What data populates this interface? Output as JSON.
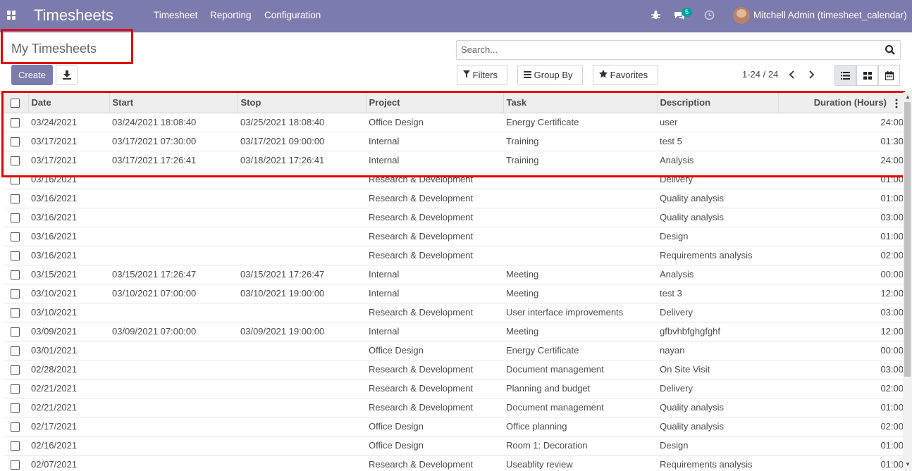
{
  "navbar": {
    "brand": "Timesheets",
    "menus": [
      "Timesheet",
      "Reporting",
      "Configuration"
    ],
    "chat_badge": "5",
    "user": "Mitchell Admin (timesheet_calendar)",
    "color": "#7c7bad"
  },
  "control": {
    "title": "My Timesheets",
    "create_label": "Create",
    "search_placeholder": "Search...",
    "filters_label": "Filters",
    "group_by_label": "Group By",
    "favorites_label": "Favorites",
    "pager": "1-24 / 24"
  },
  "table": {
    "columns": [
      "Date",
      "Start",
      "Stop",
      "Project",
      "Task",
      "Description",
      "Duration (Hours)"
    ],
    "rows": [
      [
        "03/24/2021",
        "03/24/2021 18:08:40",
        "03/25/2021 18:08:40",
        "Office Design",
        "Energy Certificate",
        "user",
        "24:00"
      ],
      [
        "03/17/2021",
        "03/17/2021 07:30:00",
        "03/17/2021 09:00:00",
        "Internal",
        "Training",
        "test 5",
        "01:30"
      ],
      [
        "03/17/2021",
        "03/17/2021 17:26:41",
        "03/18/2021 17:26:41",
        "Internal",
        "Training",
        "Analysis",
        "24:00"
      ],
      [
        "03/16/2021",
        "",
        "",
        "Research & Development",
        "",
        "Delivery",
        "01:00"
      ],
      [
        "03/16/2021",
        "",
        "",
        "Research & Development",
        "",
        "Quality analysis",
        "01:00"
      ],
      [
        "03/16/2021",
        "",
        "",
        "Research & Development",
        "",
        "Quality analysis",
        "03:00"
      ],
      [
        "03/16/2021",
        "",
        "",
        "Research & Development",
        "",
        "Design",
        "01:00"
      ],
      [
        "03/16/2021",
        "",
        "",
        "Research & Development",
        "",
        "Requirements analysis",
        "02:00"
      ],
      [
        "03/15/2021",
        "03/15/2021 17:26:47",
        "03/15/2021 17:26:47",
        "Internal",
        "Meeting",
        "Analysis",
        "00:00"
      ],
      [
        "03/10/2021",
        "03/10/2021 07:00:00",
        "03/10/2021 19:00:00",
        "Internal",
        "Meeting",
        "test 3",
        "12:00"
      ],
      [
        "03/10/2021",
        "",
        "",
        "Research & Development",
        "User interface improvements",
        "Delivery",
        "03:00"
      ],
      [
        "03/09/2021",
        "03/09/2021 07:00:00",
        "03/09/2021 19:00:00",
        "Internal",
        "Meeting",
        "gfbvhbfghgfghf",
        "12:00"
      ],
      [
        "03/01/2021",
        "",
        "",
        "Office Design",
        "Energy Certificate",
        "nayan",
        "00:00"
      ],
      [
        "02/28/2021",
        "",
        "",
        "Research & Development",
        "Document management",
        "On Site Visit",
        "03:00"
      ],
      [
        "02/21/2021",
        "",
        "",
        "Research & Development",
        "Planning and budget",
        "Delivery",
        "02:00"
      ],
      [
        "02/21/2021",
        "",
        "",
        "Research & Development",
        "Document management",
        "Quality analysis",
        "01:00"
      ],
      [
        "02/17/2021",
        "",
        "",
        "Office Design",
        "Office planning",
        "Quality analysis",
        "02:00"
      ],
      [
        "02/16/2021",
        "",
        "",
        "Office Design",
        "Room 1: Decoration",
        "Design",
        "01:00"
      ],
      [
        "02/07/2021",
        "",
        "",
        "Research & Development",
        "Useablity review",
        "Requirements analysis",
        "01:00"
      ]
    ]
  }
}
